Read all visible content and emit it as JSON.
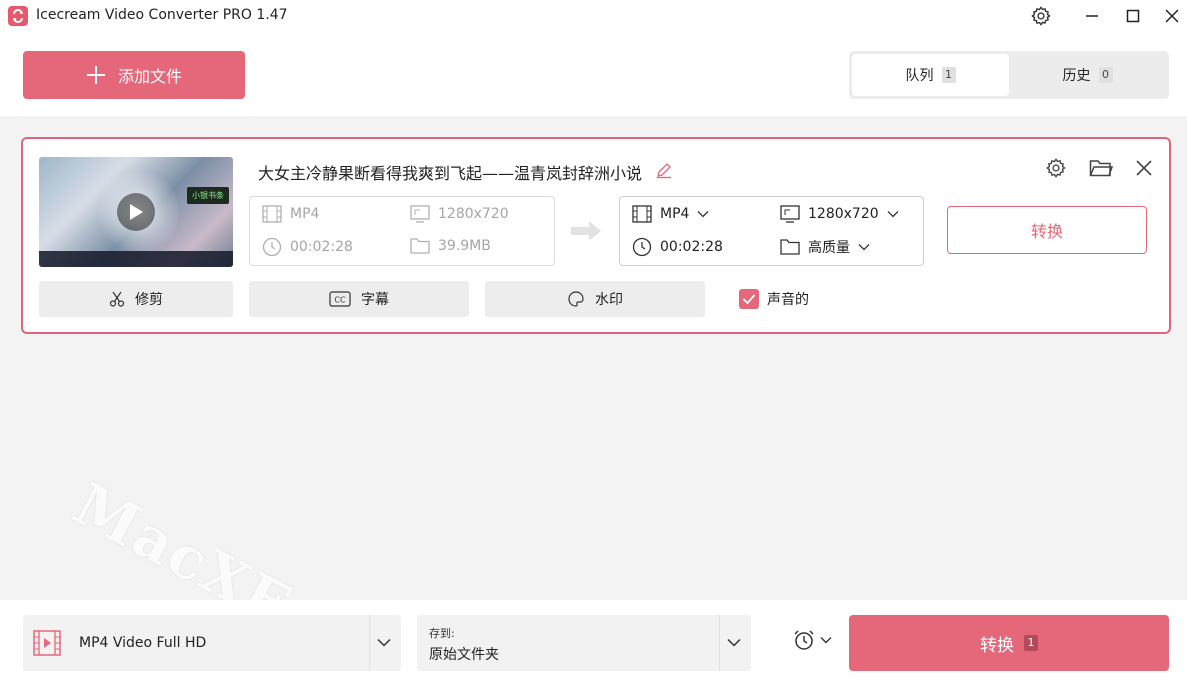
{
  "window": {
    "title": "Icecream Video Converter PRO 1.47"
  },
  "header": {
    "add_file_label": "添加文件",
    "tabs": [
      {
        "label": "队列",
        "count": "1"
      },
      {
        "label": "历史",
        "count": "0"
      }
    ]
  },
  "item": {
    "title": "大女主冷静果断看得我爽到飞起——温青岚封辞洲小说",
    "thumbnail_tag": "小银书条",
    "source": {
      "format": "MP4",
      "resolution": "1280x720",
      "duration": "00:02:28",
      "size": "39.9MB"
    },
    "output": {
      "format": "MP4",
      "resolution": "1280x720",
      "duration": "00:02:28",
      "quality": "高质量"
    },
    "convert_label": "转换",
    "tools": {
      "trim": "修剪",
      "subtitles": "字幕",
      "watermark": "水印"
    },
    "sound_label": "声音的",
    "sound_checked": true
  },
  "watermark_text": "MacXF.com",
  "footer": {
    "preset": "MP4 Video Full HD",
    "save_label": "存到:",
    "save_value": "原始文件夹",
    "convert_label": "转换",
    "convert_count": "1"
  },
  "colors": {
    "accent": "#e5677a",
    "background": "#f3f3f3"
  }
}
